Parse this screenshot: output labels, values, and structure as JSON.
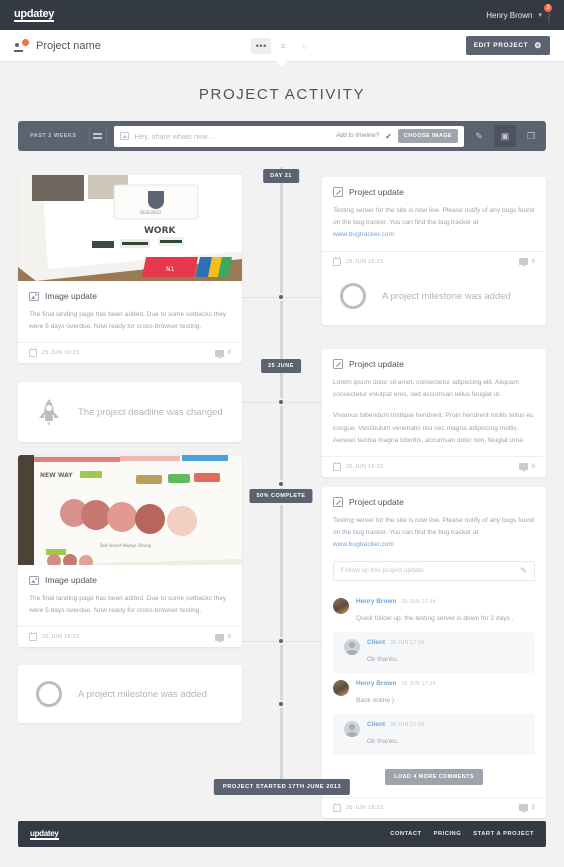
{
  "topnav": {
    "logo": "updatey",
    "user_name": "Henry Brown",
    "caret": "▾",
    "notification_count": "3"
  },
  "subheader": {
    "project_title": "Project name",
    "view_dots": "•••",
    "view_list": "≡",
    "view_circle": "○",
    "edit_project_label": "EDIT PROJECT",
    "gear": "⚙"
  },
  "page": {
    "title": "PROJECT ACTIVITY"
  },
  "composer": {
    "past_weeks_label": "PAST 2 WEEKS",
    "placeholder": "Hey, share whats new ...",
    "add_to_timeline_label": "Add to timeline?",
    "check": "✓",
    "choose_image_label": "CHOOSE IMAGE",
    "tool_edit": "✎",
    "tool_image": "▣",
    "tool_file": "❐"
  },
  "timeline": {
    "badges": {
      "day21": "DAY 21",
      "june25": "25 JUNE",
      "complete50": "50% COMPLETE",
      "started": "PROJECT STARTED 17TH JUNE 2013"
    }
  },
  "cards": {
    "left_image_1": {
      "head_icon": "image-icon",
      "title": "Image update",
      "text": "The final landing page has been added. Due to some setbacks they were 5 days overdue. Now ready for cross-browser testing.",
      "time": "25 JUN 16:23",
      "comments": "8"
    },
    "left_milestone_rocket": {
      "text": "The project deadline was changed"
    },
    "left_image_2": {
      "head_icon": "image-icon",
      "title": "Image update",
      "text": "The final landing page has been added. Due to some setbacks they were 5 days overdue. Now ready for cross-browser testing.",
      "time": "25 JUN 16:23",
      "comments": "8"
    },
    "left_milestone_circle": {
      "text": "A project milestone was added"
    },
    "right_update_1": {
      "title": "Project update",
      "text_pre": "Testing server for the site is now live. Please notify of any bugs found on the bug tracker. You can find the bug tracker at ",
      "link": "www.bugtracker.com",
      "time": "25 JUN 16:23",
      "comments": "8"
    },
    "right_milestone": {
      "text": "A project milestone was added"
    },
    "right_update_2": {
      "title": "Project update",
      "paragraph_1": "Lorem ipsum dolor sit amet, consectetur adipiscing elit. Aliquam consectetur volutpat eros, sed accumsan tellus feugiat ut.",
      "paragraph_2": "Vivamus bibendum tristique hendrerit. Proin hendrerit mollis tellus eu congue. Vestibulum venenatis nisi nec magna adipiscing mollis. Aenean lacinia magna lobortis, accumsan dolor non, feugiat urna",
      "time": "25 JUN 16:23",
      "comments": "8"
    },
    "right_update_3": {
      "title": "Project update",
      "text_pre": "Testing server for the site is now live. Please notify of any bugs found on the bug tracker. You can find the bug tracker at ",
      "link": "www.bugtracker.com",
      "followup_placeholder": "Follow up this project update",
      "followup_icon": "✎",
      "comments_list": [
        {
          "name": "Henry Brown",
          "time": "20 JUN 17:34",
          "body": "Quick follow up, the testing server is down for 2 days .",
          "avatar": "photo"
        },
        {
          "name": "Client",
          "time": "20 JUN 17:34",
          "body": "Ok thanks.",
          "avatar": "grey"
        },
        {
          "name": "Henry Brown",
          "time": "20 JUN 17:34",
          "body": "Back online )",
          "avatar": "photo"
        },
        {
          "name": "Client",
          "time": "20 JUN 17:34",
          "body": "Ok thanks.",
          "avatar": "grey"
        }
      ],
      "load_more_label": "LOAD 4 MORE COMMENTS",
      "time": "25 JUN 16:23",
      "comments": "8"
    }
  },
  "footer": {
    "logo": "updatey",
    "links": [
      "CONTACT",
      "PRICING",
      "START A PROJECT"
    ]
  }
}
